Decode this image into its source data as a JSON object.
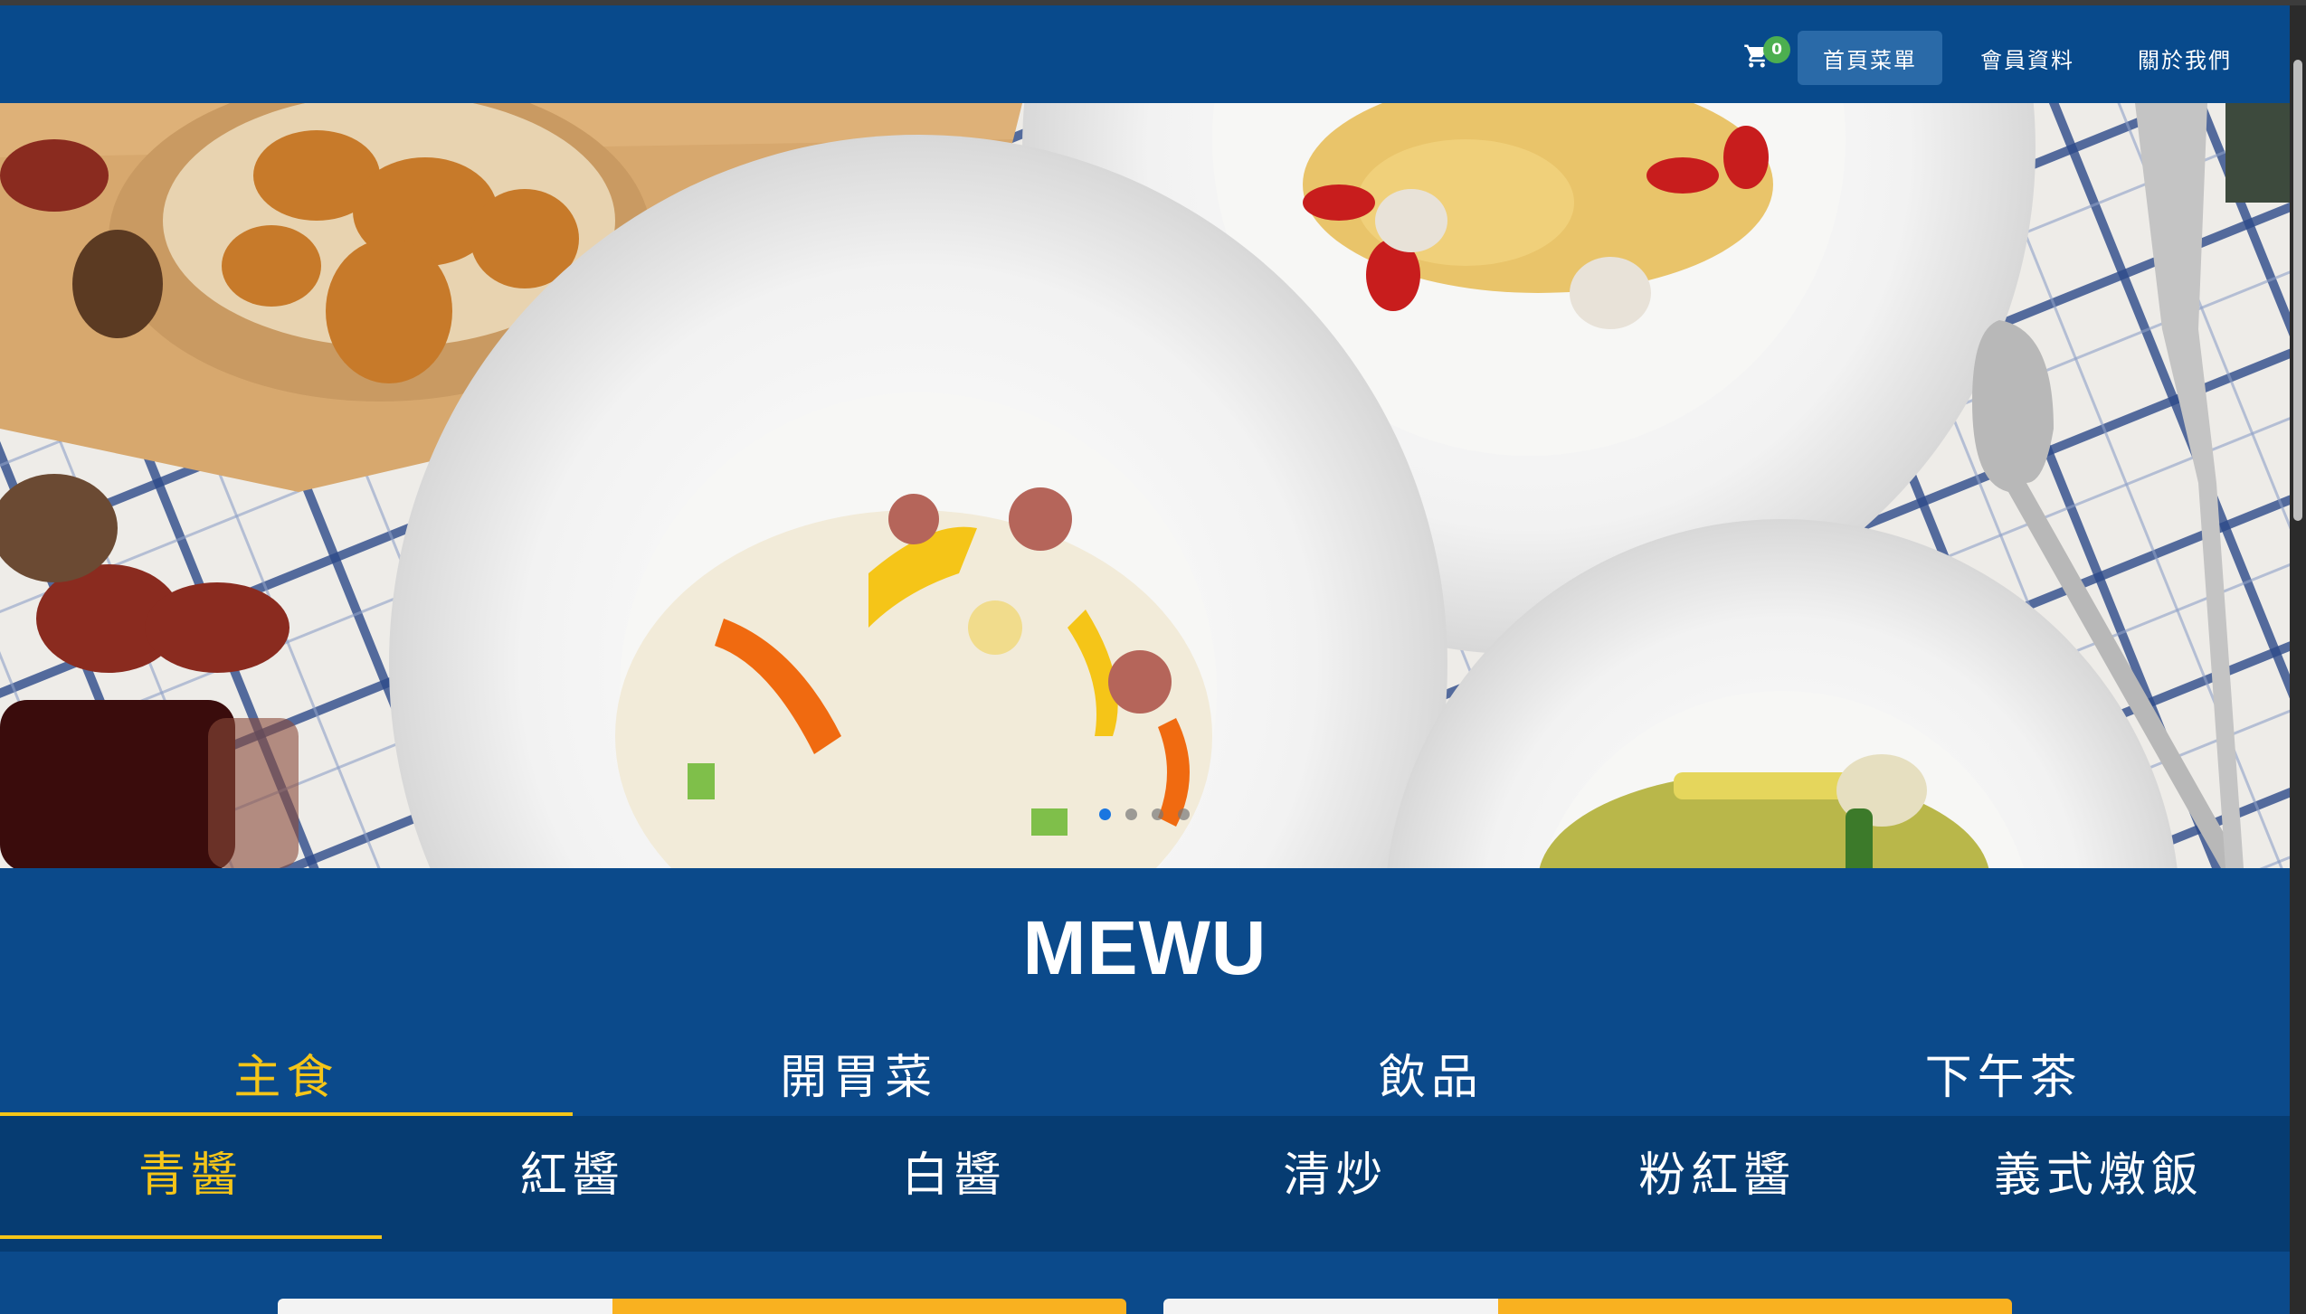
{
  "navbar": {
    "cart_count": "0",
    "links": [
      "首頁菜單",
      "會員資料",
      "關於我們"
    ],
    "active_link": 0
  },
  "hero": {
    "slides": 4,
    "active_slide": 0
  },
  "menu_title": "MEWU",
  "categories": [
    "主食",
    "開胃菜",
    "飲品",
    "下午茶"
  ],
  "active_category": 0,
  "subcategories": [
    "青醬",
    "紅醬",
    "白醬",
    "清炒",
    "粉紅醬",
    "義式燉飯"
  ],
  "active_subcategory": 0,
  "colors": {
    "brand": "#084a8c",
    "accent": "#f5c518",
    "badge": "#4caf50",
    "card_accent": "#f9b120"
  },
  "icons": [
    "cart-icon"
  ]
}
